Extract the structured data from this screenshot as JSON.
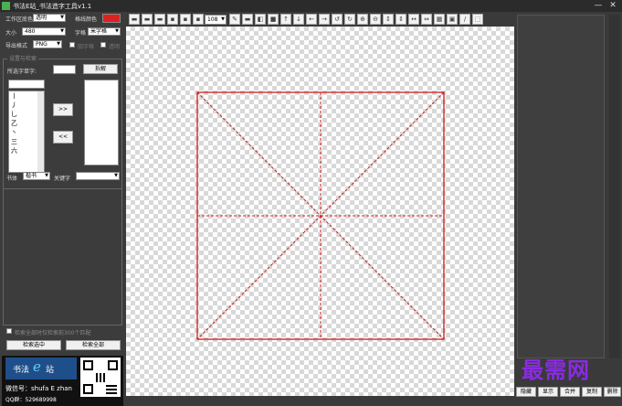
{
  "window": {
    "title": "书法E站_书法造字工具v1.1",
    "controls": [
      "—",
      "✕"
    ]
  },
  "settings": {
    "bg_label": "工作区底色",
    "bg_value": "透明",
    "line_color_label": "格线颜色",
    "line_color": "#e02020",
    "size_label": "大小",
    "size_value": "480",
    "grid_label": "字格",
    "grid_value": "米字格",
    "export_label": "导出格式",
    "export_value": "PNG",
    "check1_label": "田字格",
    "check2_label": "透明"
  },
  "search": {
    "group_label": "设置与检索",
    "char_label": "所选字单字:",
    "char_value": "",
    "split_button": "拆解",
    "list_items": [
      "丨",
      "丿",
      "乚",
      "乙",
      "丶",
      "三",
      "六"
    ],
    "move_right": ">>",
    "move_left": "<<",
    "style_label": "书体",
    "style_value": "楷书",
    "keyword_label": "关键字",
    "keyword_value": "",
    "bottom_check_label": "检索全部时仅检索前300个匹配",
    "search_selected": "检索选中",
    "search_all": "检索全部"
  },
  "promo": {
    "logo_text": "书法",
    "logo_e": "e",
    "logo_suffix": "站",
    "wechat": "微信号：shufa E zhan",
    "qq": "QQ群：529689998"
  },
  "toolbar": {
    "zoom_value": "108"
  },
  "canvas": {
    "grid_color": "#d01818"
  },
  "right": {
    "watermark": "最需网",
    "buttons": [
      "隐藏",
      "显示",
      "合并",
      "复制",
      "删除"
    ]
  }
}
